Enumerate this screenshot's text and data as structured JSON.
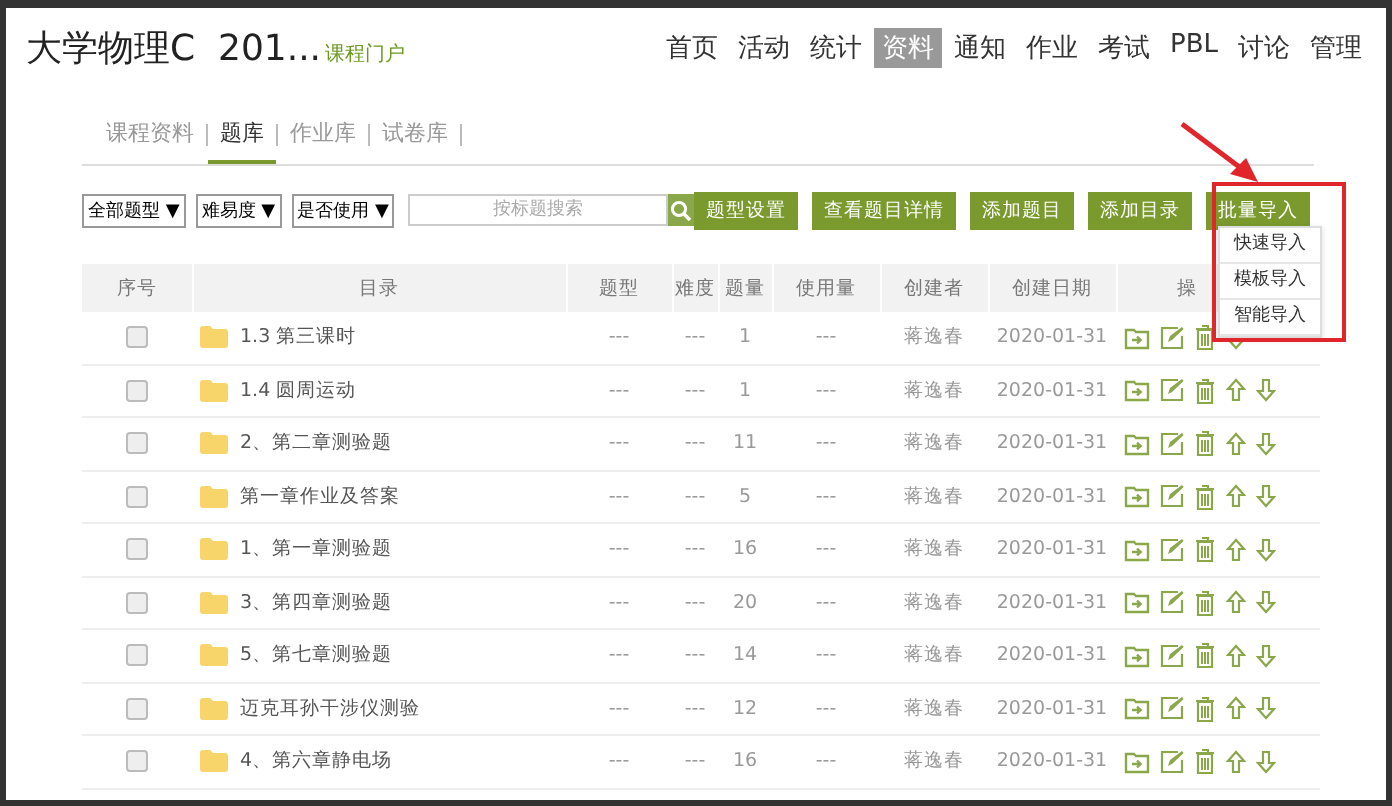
{
  "header": {
    "title": "大学物理C  201...",
    "portal_link": "课程门户",
    "nav": [
      {
        "label": "首页",
        "selected": false
      },
      {
        "label": "活动",
        "selected": false
      },
      {
        "label": "统计",
        "selected": false
      },
      {
        "label": "资料",
        "selected": true
      },
      {
        "label": "通知",
        "selected": false
      },
      {
        "label": "作业",
        "selected": false
      },
      {
        "label": "考试",
        "selected": false
      },
      {
        "label": "PBL",
        "selected": false
      },
      {
        "label": "讨论",
        "selected": false
      },
      {
        "label": "管理",
        "selected": false
      }
    ]
  },
  "sub_tabs": [
    {
      "label": "课程资料",
      "selected": false
    },
    {
      "label": "题库",
      "selected": true
    },
    {
      "label": "作业库",
      "selected": false
    },
    {
      "label": "试卷库",
      "selected": false
    }
  ],
  "filters": [
    {
      "label": "全部题型",
      "caret": "▼"
    },
    {
      "label": "难易度",
      "caret": "▼"
    },
    {
      "label": "是否使用",
      "caret": "▼"
    }
  ],
  "search": {
    "placeholder": "按标题搜索"
  },
  "buttons": [
    "题型设置",
    "查看题目详情",
    "添加题目",
    "添加目录",
    "批量导入"
  ],
  "import_menu": {
    "items": [
      "快速导入",
      "模板导入",
      "智能导入"
    ]
  },
  "table": {
    "columns": [
      "序号",
      "目录",
      "题型",
      "难度",
      "题量",
      "使用量",
      "创建者",
      "创建日期",
      "操"
    ],
    "rows": [
      {
        "checked": false,
        "title": "1.3 第三课时",
        "type": "---",
        "difficulty": "---",
        "count": "1",
        "usage": "---",
        "creator": "蒋逸春",
        "date": "2020-01-31",
        "can_move_up": false
      },
      {
        "checked": false,
        "title": "1.4 圆周运动",
        "type": "---",
        "difficulty": "---",
        "count": "1",
        "usage": "---",
        "creator": "蒋逸春",
        "date": "2020-01-31",
        "can_move_up": true
      },
      {
        "checked": false,
        "title": "2、第二章测验题",
        "type": "---",
        "difficulty": "---",
        "count": "11",
        "usage": "---",
        "creator": "蒋逸春",
        "date": "2020-01-31",
        "can_move_up": true
      },
      {
        "checked": false,
        "title": "第一章作业及答案",
        "type": "---",
        "difficulty": "---",
        "count": "5",
        "usage": "---",
        "creator": "蒋逸春",
        "date": "2020-01-31",
        "can_move_up": true
      },
      {
        "checked": false,
        "title": "1、第一章测验题",
        "type": "---",
        "difficulty": "---",
        "count": "16",
        "usage": "---",
        "creator": "蒋逸春",
        "date": "2020-01-31",
        "can_move_up": true
      },
      {
        "checked": false,
        "title": "3、第四章测验题",
        "type": "---",
        "difficulty": "---",
        "count": "20",
        "usage": "---",
        "creator": "蒋逸春",
        "date": "2020-01-31",
        "can_move_up": true
      },
      {
        "checked": false,
        "title": "5、第七章测验题",
        "type": "---",
        "difficulty": "---",
        "count": "14",
        "usage": "---",
        "creator": "蒋逸春",
        "date": "2020-01-31",
        "can_move_up": true
      },
      {
        "checked": false,
        "title": "迈克耳孙干涉仪测验",
        "type": "---",
        "difficulty": "---",
        "count": "12",
        "usage": "---",
        "creator": "蒋逸春",
        "date": "2020-01-31",
        "can_move_up": true
      },
      {
        "checked": false,
        "title": "4、第六章静电场",
        "type": "---",
        "difficulty": "---",
        "count": "16",
        "usage": "---",
        "creator": "蒋逸春",
        "date": "2020-01-31",
        "can_move_up": true
      }
    ]
  }
}
